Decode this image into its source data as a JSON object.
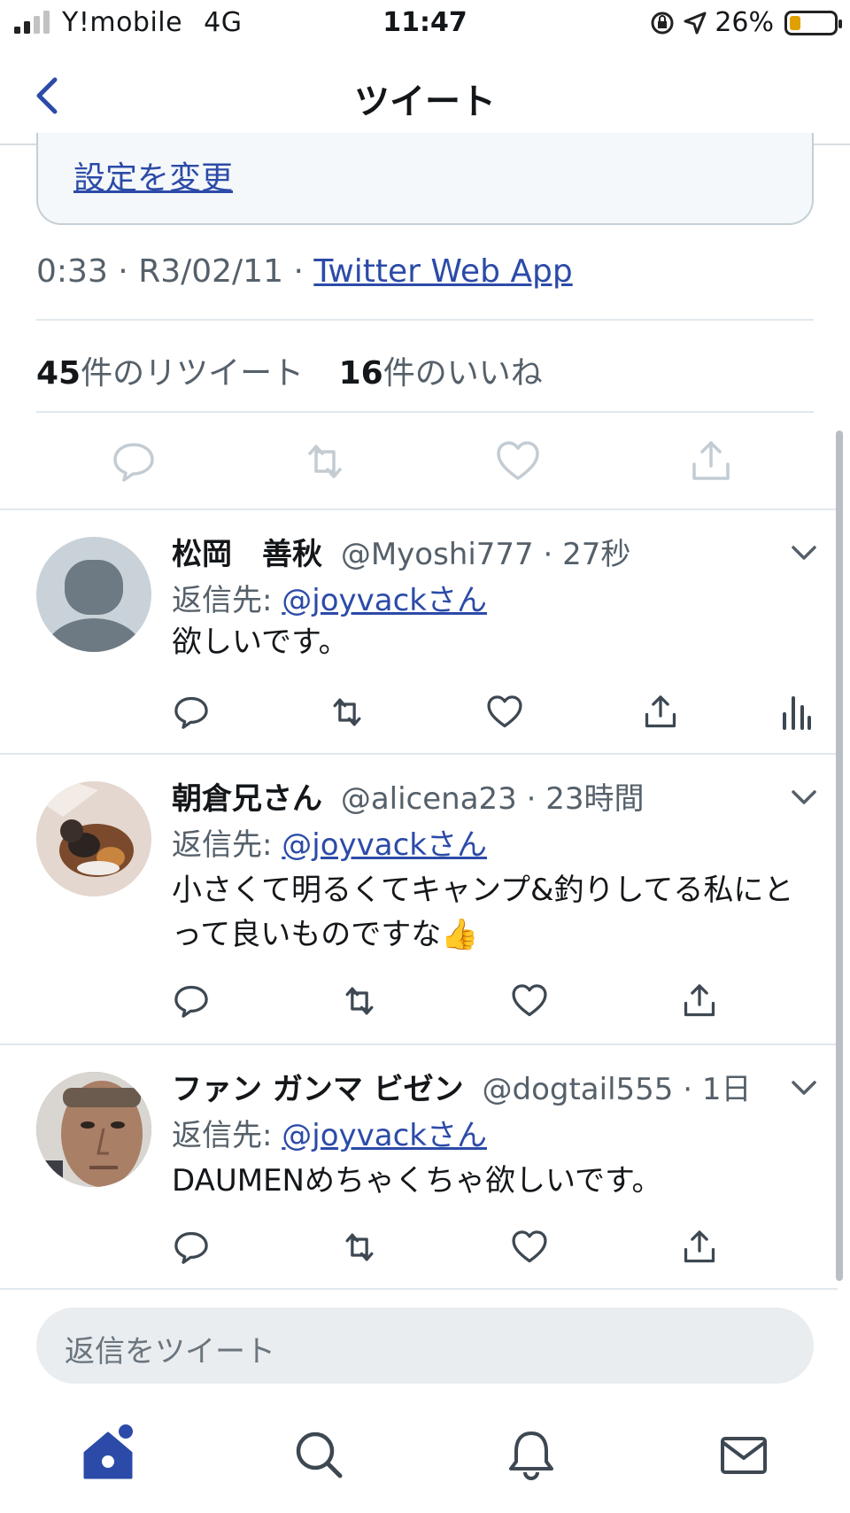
{
  "status_bar": {
    "carrier": "Y!mobile",
    "network": "4G",
    "time": "11:47",
    "battery_percent": "26%",
    "battery_level": 0.26,
    "battery_color": "#e0a100"
  },
  "nav": {
    "title": "ツイート",
    "back_icon": "chevron-left-icon"
  },
  "tweet": {
    "settings_link": "設定を変更",
    "time": "0:33",
    "date": "R3/02/11",
    "source": "Twitter Web App",
    "retweet_count": "45",
    "retweet_label": "件のリツイート",
    "like_count": "16",
    "like_label": "件のいいね"
  },
  "replies": [
    {
      "name": "松岡　善秋",
      "handle": "@Myoshi777",
      "age": "27秒",
      "reply_prefix": "返信先: ",
      "reply_to": "@joyvackさん",
      "text": "欲しいです。"
    },
    {
      "name": "朝倉兄さん",
      "handle": "@alicena23",
      "age": "23時間",
      "reply_prefix": "返信先: ",
      "reply_to": "@joyvackさん",
      "text": "小さくて明るくてキャンプ&釣りしてる私にとって良いものですな👍"
    },
    {
      "name": "ファン ガンマ ビゼン",
      "handle": "@dogtail555",
      "age": "1日",
      "reply_prefix": "返信先: ",
      "reply_to": "@joyvackさん",
      "text": "DAUMENめちゃくちゃ欲しいです。"
    }
  ],
  "compose": {
    "placeholder": "返信をツイート"
  },
  "tabbar": {
    "items": [
      "home-icon",
      "search-icon",
      "bell-icon",
      "mail-icon"
    ],
    "accent": "#2c4ba8"
  }
}
